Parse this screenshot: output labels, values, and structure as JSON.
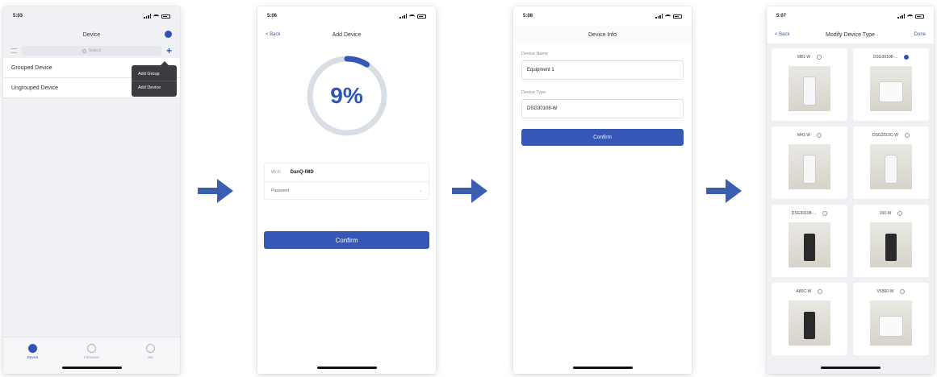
{
  "colors": {
    "accent": "#3657b5",
    "arrow": "#3b5fb0",
    "popover": "#3b3c42"
  },
  "flow_arrow_icon": "right-arrow-icon",
  "screen1": {
    "time": "5:03",
    "title": "Device",
    "search_placeholder": "Search",
    "rows": [
      "Grouped Device",
      "Ungrouped Device"
    ],
    "popover": [
      "Add Group",
      "Add Device"
    ],
    "tabs": [
      {
        "label": "Device",
        "icon": "device-icon"
      },
      {
        "label": "Firmware",
        "icon": "firmware-icon"
      },
      {
        "label": "Me",
        "icon": "profile-icon"
      }
    ]
  },
  "screen2": {
    "time": "5:06",
    "back": "< Back",
    "title": "Add Device",
    "progress_text": "9%",
    "progress": 0.09,
    "wifi_label": "Wi-Fi",
    "wifi_name": "DanQ-IMD",
    "password_placeholder": "Password",
    "confirm": "Confirm"
  },
  "screen3": {
    "time": "5:08",
    "title": "Device Info",
    "name_label": "Device Name",
    "name_value": "Equipment 1",
    "type_label": "Device Type",
    "type_value": "DSG30108-W",
    "confirm": "Confirm"
  },
  "screen4": {
    "time": "5:07",
    "back": "< Back",
    "title": "Modify Device Type",
    "done": "Done",
    "items": [
      {
        "name": "M81-W",
        "selected": false
      },
      {
        "name": "DSG30108-...",
        "selected": true
      },
      {
        "name": "M41-W",
        "selected": false
      },
      {
        "name": "DSG2010C-W",
        "selected": false
      },
      {
        "name": "DSG30108-...",
        "selected": false
      },
      {
        "name": "160-W",
        "selected": false
      },
      {
        "name": "A80C-W",
        "selected": false
      },
      {
        "name": "V5560-W",
        "selected": false
      }
    ]
  }
}
